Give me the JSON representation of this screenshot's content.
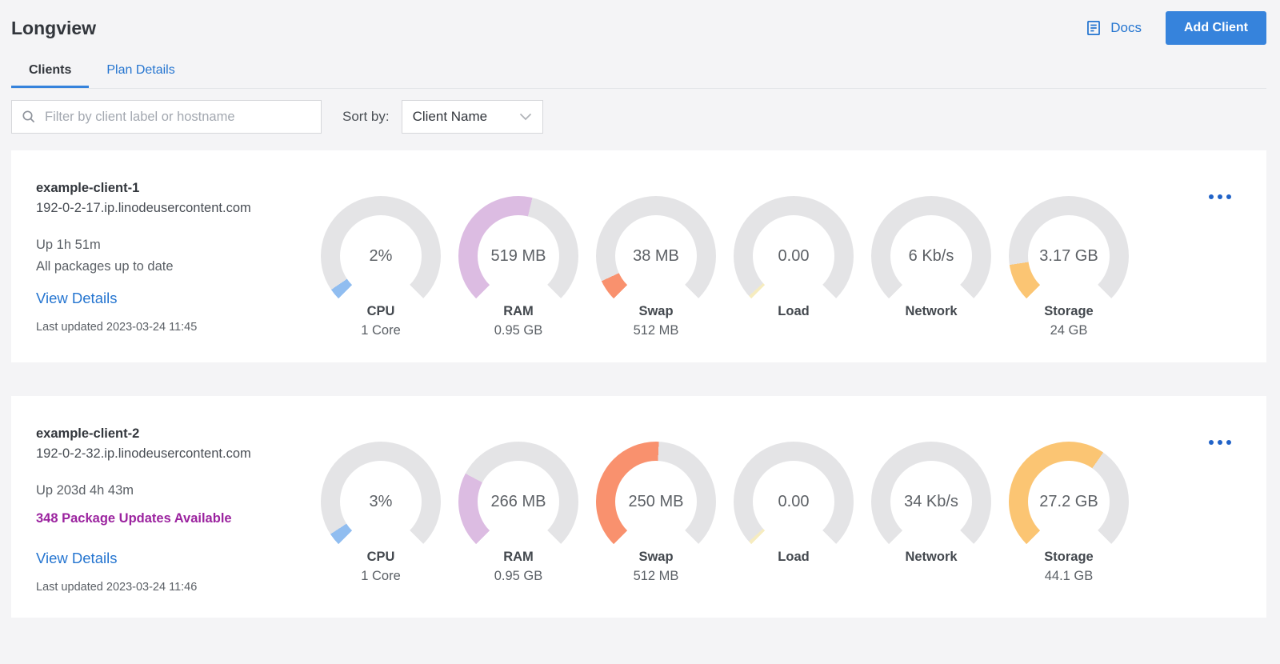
{
  "header": {
    "title": "Longview",
    "docs_label": "Docs",
    "add_client_label": "Add Client"
  },
  "tabs": [
    {
      "label": "Clients",
      "active": true
    },
    {
      "label": "Plan Details",
      "active": false
    }
  ],
  "filter": {
    "search_placeholder": "Filter by client label or hostname",
    "sort_by_label": "Sort by:",
    "sort_value": "Client Name"
  },
  "colors": {
    "accent_blue": "#3683dc",
    "link_blue": "#2575d0",
    "alert_purple": "#9b239f",
    "ellipsis_blue": "#2163c8",
    "gauge_track": "#e4e4e6",
    "page_bg": "#f4f4f6"
  },
  "clients": [
    {
      "name": "example-client-1",
      "hostname": "192-0-2-17.ip.linodeusercontent.com",
      "uptime": "Up 1h 51m",
      "packages_status": "All packages up to date",
      "packages_alert": false,
      "view_details_label": "View Details",
      "last_updated": "Last updated 2023-03-24 11:45",
      "gauges": [
        {
          "value": "2%",
          "label": "CPU",
          "sublabel": "1 Core",
          "fraction": 0.04,
          "color": "#90bdf0"
        },
        {
          "value": "519 MB",
          "label": "RAM",
          "sublabel": "0.95 GB",
          "fraction": 0.55,
          "color": "#dcbce2"
        },
        {
          "value": "38 MB",
          "label": "Swap",
          "sublabel": "512 MB",
          "fraction": 0.075,
          "color": "#f9916e"
        },
        {
          "value": "0.00",
          "label": "Load",
          "sublabel": "",
          "fraction": 0.012,
          "color": "#f6ecbf"
        },
        {
          "value": "6 Kb/s",
          "label": "Network",
          "sublabel": "",
          "fraction": 0,
          "color": ""
        },
        {
          "value": "3.17 GB",
          "label": "Storage",
          "sublabel": "24 GB",
          "fraction": 0.135,
          "color": "#fbc573"
        }
      ]
    },
    {
      "name": "example-client-2",
      "hostname": "192-0-2-32.ip.linodeusercontent.com",
      "uptime": "Up 203d 4h 43m",
      "packages_status": "348 Package Updates Available",
      "packages_alert": true,
      "view_details_label": "View Details",
      "last_updated": "Last updated 2023-03-24 11:46",
      "gauges": [
        {
          "value": "3%",
          "label": "CPU",
          "sublabel": "1 Core",
          "fraction": 0.045,
          "color": "#90bdf0"
        },
        {
          "value": "266 MB",
          "label": "RAM",
          "sublabel": "0.95 GB",
          "fraction": 0.27,
          "color": "#dcbce2"
        },
        {
          "value": "250 MB",
          "label": "Swap",
          "sublabel": "512 MB",
          "fraction": 0.51,
          "color": "#f9916e"
        },
        {
          "value": "0.00",
          "label": "Load",
          "sublabel": "",
          "fraction": 0.012,
          "color": "#f6ecbf"
        },
        {
          "value": "34 Kb/s",
          "label": "Network",
          "sublabel": "",
          "fraction": 0,
          "color": ""
        },
        {
          "value": "27.2 GB",
          "label": "Storage",
          "sublabel": "44.1 GB",
          "fraction": 0.63,
          "color": "#fbc573"
        }
      ]
    }
  ]
}
